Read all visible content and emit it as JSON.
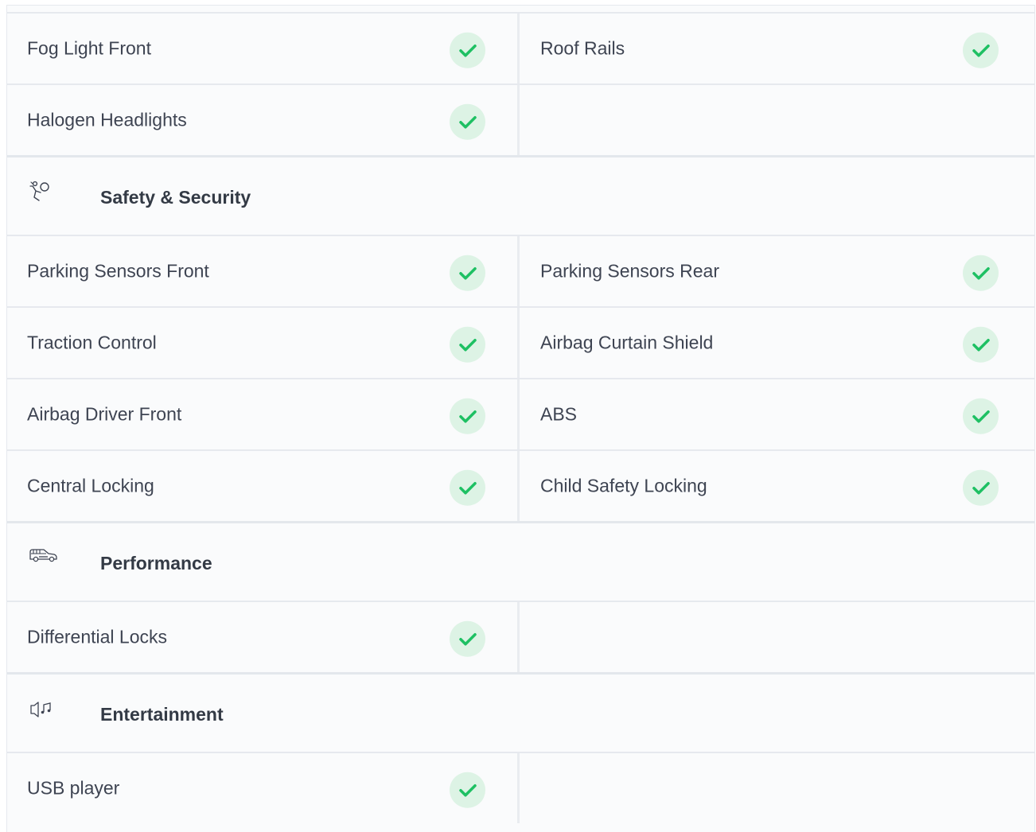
{
  "colors": {
    "check_bg": "#ddf3e5",
    "check_mark": "#1ec063",
    "divider": "#e6e9ee",
    "text": "#3e4452"
  },
  "exterior": {
    "rows": [
      {
        "left": "Fog Light Front",
        "left_checked": true,
        "right": "Roof Rails",
        "right_checked": true
      },
      {
        "left": "Halogen Headlights",
        "left_checked": true,
        "right": "",
        "right_checked": false
      }
    ]
  },
  "safety": {
    "title": "Safety & Security",
    "icon": "airbag-icon",
    "rows": [
      {
        "left": "Parking Sensors Front",
        "left_checked": true,
        "right": "Parking Sensors Rear",
        "right_checked": true
      },
      {
        "left": "Traction Control",
        "left_checked": true,
        "right": "Airbag Curtain Shield",
        "right_checked": true
      },
      {
        "left": "Airbag Driver Front",
        "left_checked": true,
        "right": "ABS",
        "right_checked": true
      },
      {
        "left": "Central Locking",
        "left_checked": true,
        "right": "Child Safety Locking",
        "right_checked": true
      }
    ]
  },
  "performance": {
    "title": "Performance",
    "icon": "car-engine-icon",
    "rows": [
      {
        "left": "Differential Locks",
        "left_checked": true,
        "right": "",
        "right_checked": false
      }
    ]
  },
  "entertainment": {
    "title": "Entertainment",
    "icon": "speaker-music-icon",
    "rows": [
      {
        "left": "USB player",
        "left_checked": true,
        "right": "",
        "right_checked": false
      }
    ]
  }
}
